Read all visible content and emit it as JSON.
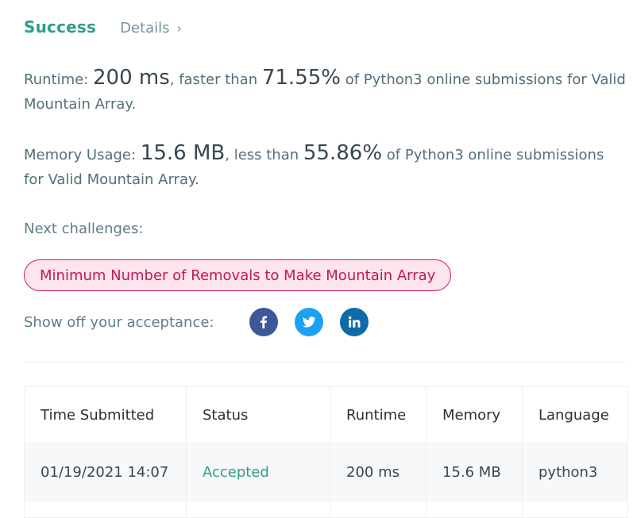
{
  "header": {
    "status": "Success",
    "details_label": "Details",
    "details_chevron": "›"
  },
  "runtime": {
    "label": "Runtime:",
    "value": "200 ms",
    "mid": ", faster than",
    "percent": "71.55%",
    "suffix": "of Python3 online submissions for Valid Mountain Array."
  },
  "memory": {
    "label": "Memory Usage:",
    "value": "15.6 MB",
    "mid": ", less than",
    "percent": "55.86%",
    "suffix": "of Python3 online submissions for Valid Mountain Array."
  },
  "next": {
    "label": "Next challenges:",
    "challenges": [
      "Minimum Number of Removals to Make Mountain Array"
    ]
  },
  "share": {
    "label": "Show off your acceptance:",
    "icons": [
      "facebook-icon",
      "twitter-icon",
      "linkedin-icon"
    ]
  },
  "table": {
    "headers": [
      "Time Submitted",
      "Status",
      "Runtime",
      "Memory",
      "Language"
    ],
    "rows": [
      {
        "time": "01/19/2021 14:07",
        "status": "Accepted",
        "runtime": "200 ms",
        "memory": "15.6 MB",
        "language": "python3"
      }
    ]
  },
  "colors": {
    "success": "#2e9e8a",
    "challenge_border": "#d81b60",
    "challenge_bg": "#fde4ed",
    "facebook": "#3b5998",
    "twitter": "#1da1f2",
    "linkedin": "#0e6ba8"
  }
}
